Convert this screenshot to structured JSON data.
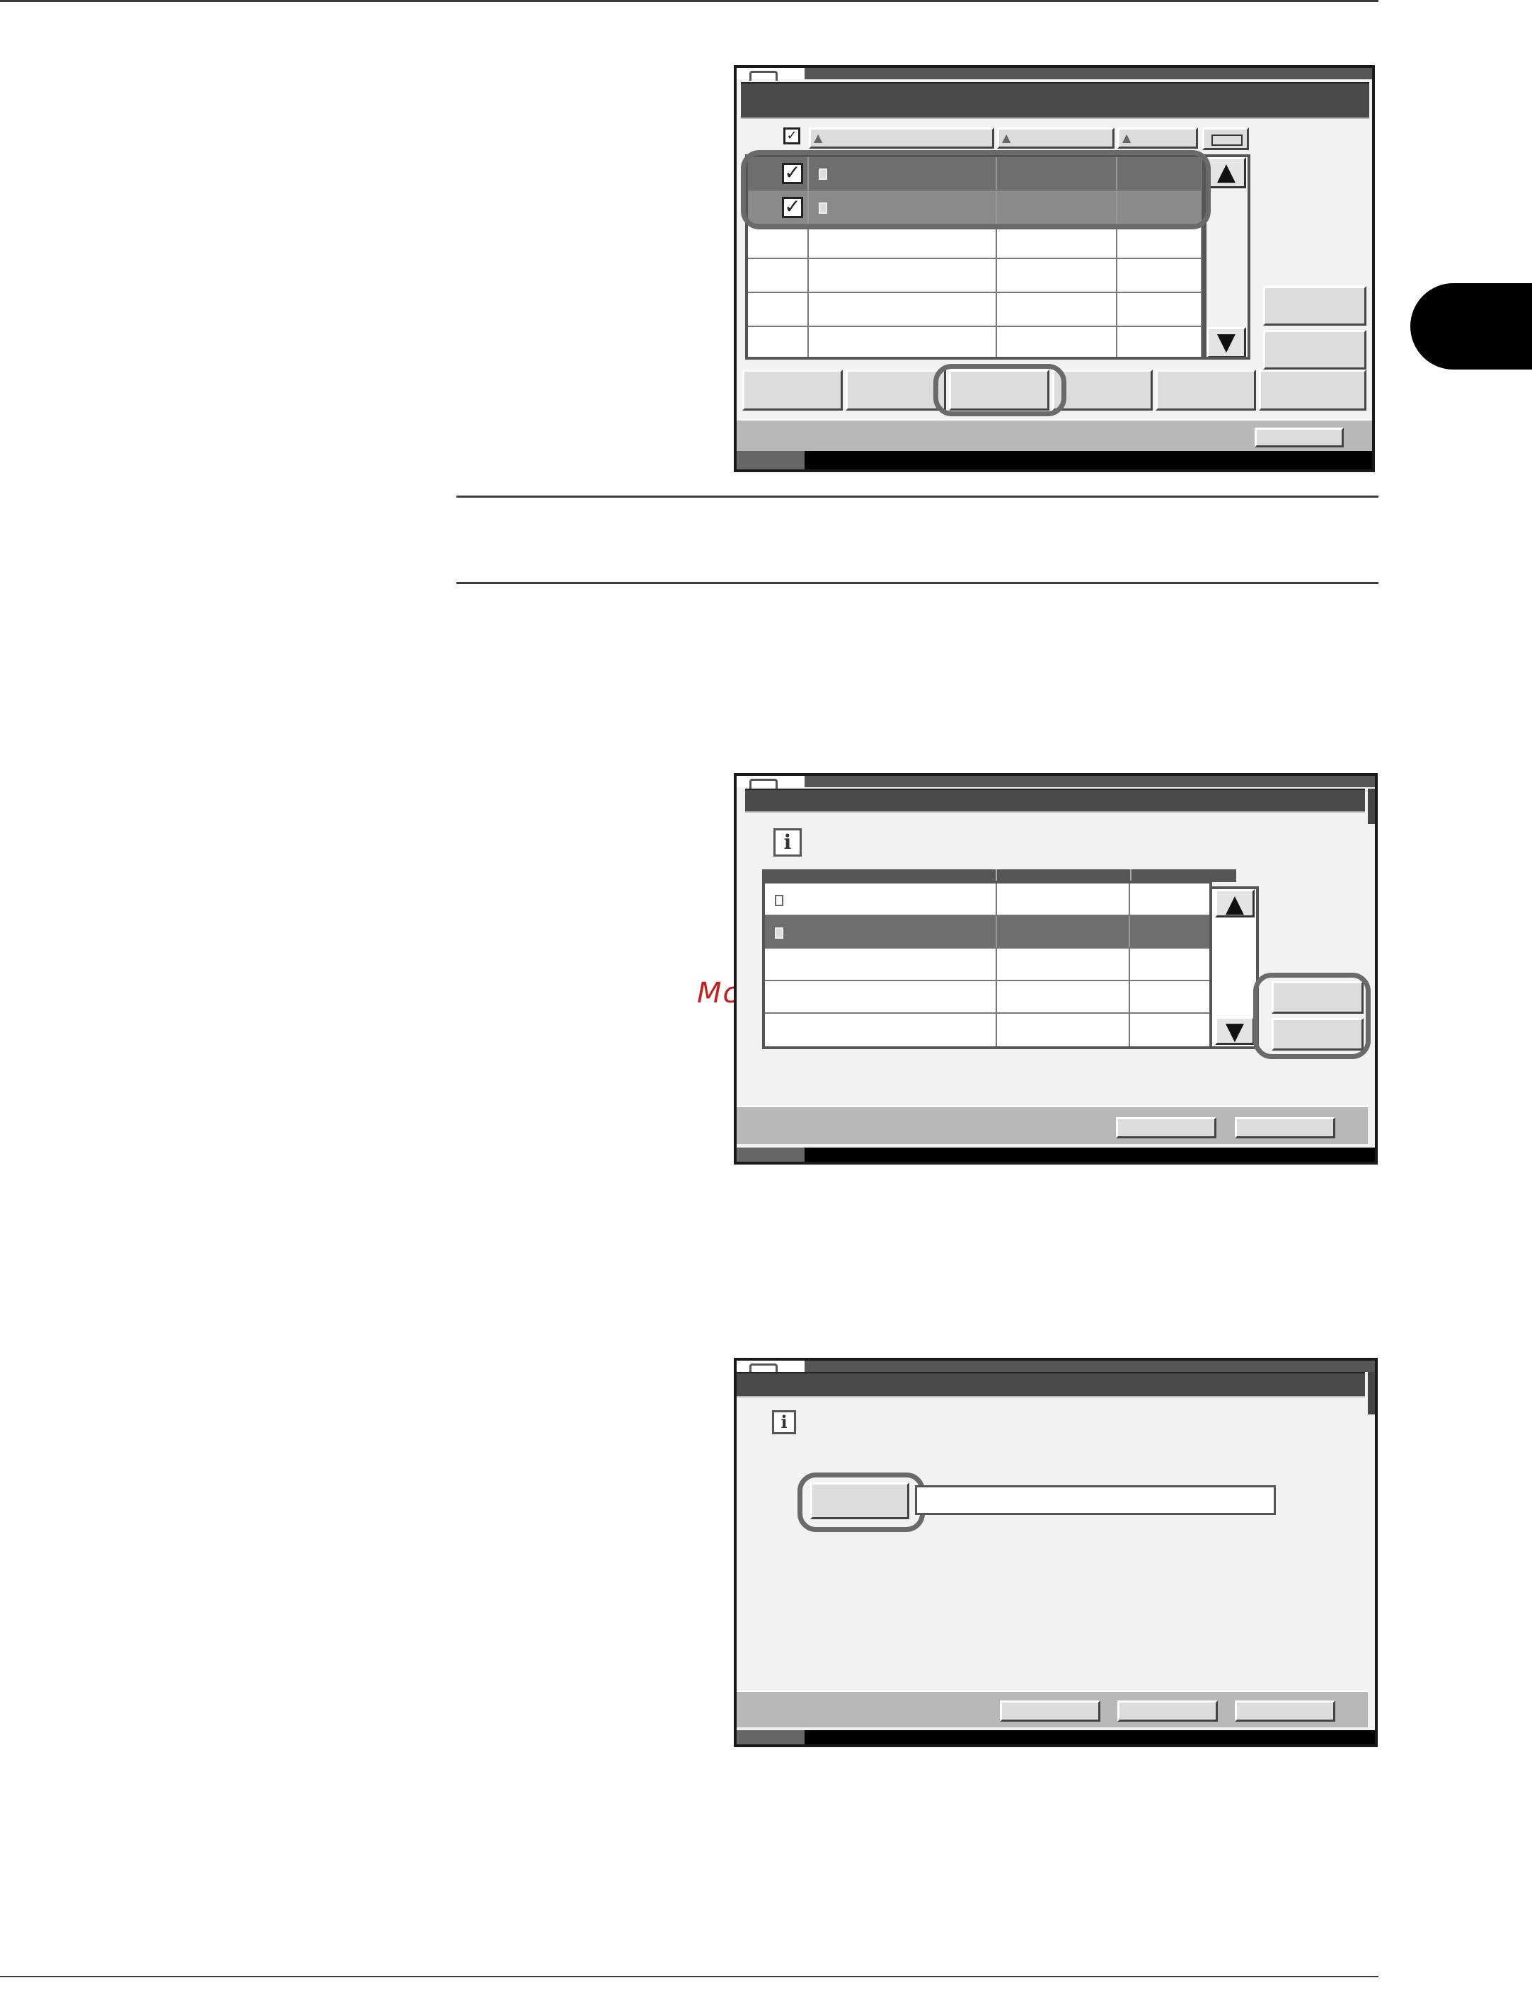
{
  "page": {
    "watermark": "McGrp.Ru"
  },
  "screen1": {
    "checkbox_mark": "✓",
    "scroll_up": "▲",
    "scroll_down": "▼",
    "sort_marker": "▲"
  },
  "screen2": {
    "info_glyph": "i",
    "scroll_up": "▲",
    "scroll_down": "▼"
  },
  "screen3": {
    "info_glyph": "i",
    "name_value": ""
  }
}
